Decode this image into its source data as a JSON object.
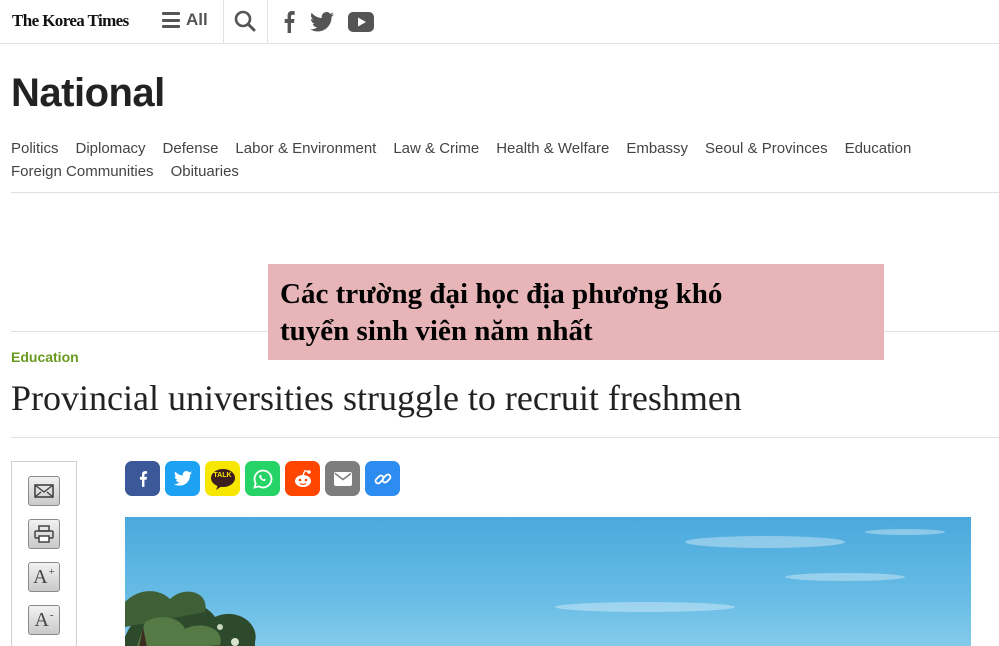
{
  "header": {
    "logo": "The Korea Times",
    "menu_label": "All",
    "icons": [
      "hamburger-icon",
      "search-icon",
      "facebook-icon",
      "twitter-icon",
      "youtube-icon"
    ]
  },
  "section": {
    "title": "National",
    "subnav": [
      "Politics",
      "Diplomacy",
      "Defense",
      "Labor & Environment",
      "Law & Crime",
      "Health & Welfare",
      "Embassy",
      "Seoul & Provinces",
      "Education",
      "Foreign Communities",
      "Obituaries"
    ]
  },
  "overlay": {
    "line1": "Các trường đại học địa phương khó",
    "line2": "tuyển sinh viên năm nhất",
    "background": "#e7b5b7"
  },
  "article": {
    "category": "Education",
    "headline": "Provincial universities struggle to recruit freshmen"
  },
  "tools": {
    "font_up": "A",
    "font_down": "A",
    "icons": [
      "email-icon",
      "print-icon",
      "font-increase-icon",
      "font-decrease-icon"
    ]
  },
  "share": {
    "kakao_label": "TALK",
    "buttons": [
      {
        "name": "facebook",
        "color": "#3b5998"
      },
      {
        "name": "twitter",
        "color": "#1da1f2"
      },
      {
        "name": "kakaotalk",
        "color": "#f7e600"
      },
      {
        "name": "whatsapp",
        "color": "#25d366"
      },
      {
        "name": "reddit",
        "color": "#ff4500"
      },
      {
        "name": "email",
        "color": "#7d7d7d"
      },
      {
        "name": "link",
        "color": "#2d8cf0"
      }
    ]
  },
  "colors": {
    "category_green": "#6a9a1f",
    "divider": "#e0e0e0"
  }
}
